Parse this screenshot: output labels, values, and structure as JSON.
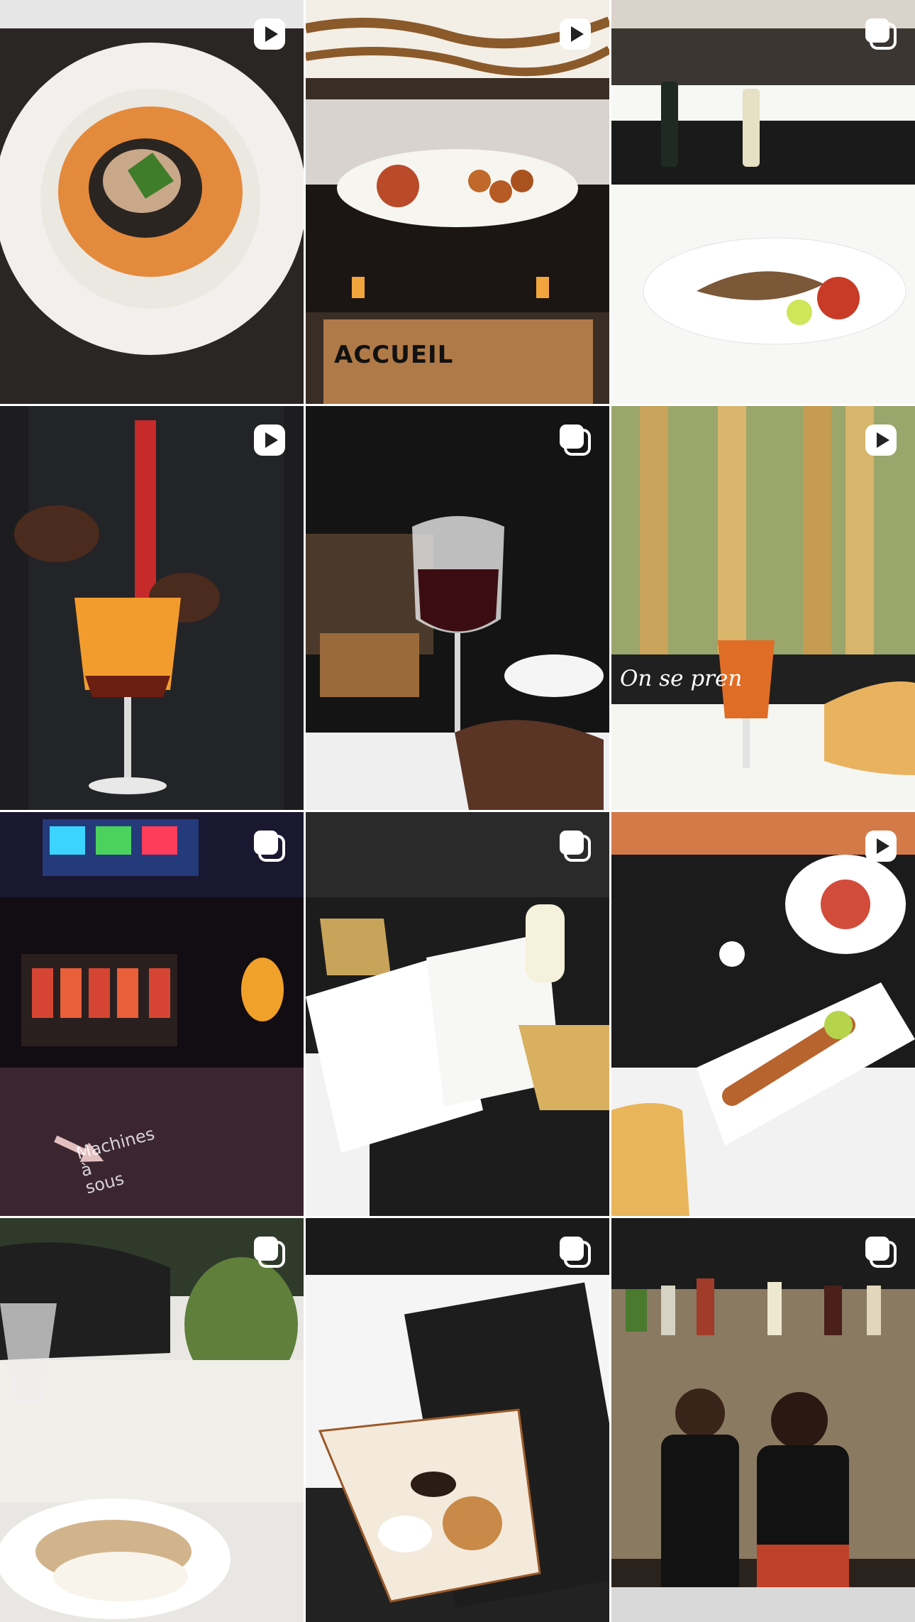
{
  "grid": {
    "posts": [
      {
        "id": 1,
        "type": "reel",
        "badge_icon": "reel-icon",
        "subject": "plated-dish-orange-sauce"
      },
      {
        "id": 2,
        "type": "reel",
        "badge_icon": "reel-icon",
        "subject": "restaurant-reception-platter",
        "sign_text": "ACCUEIL"
      },
      {
        "id": 3,
        "type": "carousel",
        "badge_icon": "carousel-icon",
        "subject": "grilled-fish-table-setting"
      },
      {
        "id": 4,
        "type": "reel",
        "badge_icon": "reel-icon",
        "subject": "bartender-orange-cocktail"
      },
      {
        "id": 5,
        "type": "carousel",
        "badge_icon": "carousel-icon",
        "subject": "red-wine-glass-hand"
      },
      {
        "id": 6,
        "type": "reel",
        "badge_icon": "reel-icon",
        "subject": "cocktail-bamboo-terrace",
        "overlay_text": "On se pren"
      },
      {
        "id": 7,
        "type": "carousel",
        "badge_icon": "carousel-icon",
        "subject": "casino-slot-machines",
        "floor_text": "Machines\nà\nsous"
      },
      {
        "id": 8,
        "type": "carousel",
        "badge_icon": "carousel-icon",
        "subject": "menu-open-table"
      },
      {
        "id": 9,
        "type": "reel",
        "badge_icon": "reel-icon",
        "subject": "skewers-table-top-view"
      },
      {
        "id": 10,
        "type": "carousel",
        "badge_icon": "carousel-icon",
        "subject": "fish-fillet-mashed"
      },
      {
        "id": 11,
        "type": "carousel",
        "badge_icon": "carousel-icon",
        "subject": "dessert-cream-puff"
      },
      {
        "id": 12,
        "type": "carousel",
        "badge_icon": "carousel-icon",
        "subject": "bar-staff-portrait"
      }
    ]
  },
  "colors": {
    "background": "#ffffff",
    "badge": "#ffffff"
  }
}
